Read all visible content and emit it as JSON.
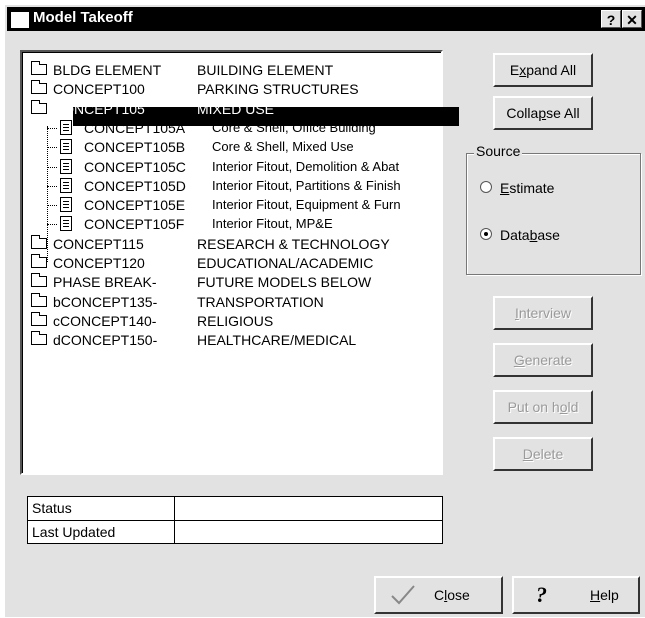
{
  "window": {
    "title": "Model Takeoff",
    "help_glyph": "?",
    "close_glyph": "✕"
  },
  "tree": {
    "nodes": [
      {
        "code": "BLDG ELEMENT",
        "desc": "BUILDING ELEMENT",
        "type": "folder"
      },
      {
        "code": "CONCEPT100",
        "desc": "PARKING STRUCTURES",
        "type": "folder"
      },
      {
        "code": "CONCEPT105",
        "desc": "MIXED USE",
        "type": "folder-open",
        "selected": true
      },
      {
        "code": "CONCEPT105A",
        "desc": "Core & Shell, Office Building",
        "type": "doc"
      },
      {
        "code": "CONCEPT105B",
        "desc": "Core & Shell, Mixed Use",
        "type": "doc"
      },
      {
        "code": "CONCEPT105C",
        "desc": "Interior Fitout, Demolition & Abat",
        "type": "doc"
      },
      {
        "code": "CONCEPT105D",
        "desc": "Interior Fitout, Partitions & Finish",
        "type": "doc"
      },
      {
        "code": "CONCEPT105E",
        "desc": "Interior Fitout, Equipment & Furn",
        "type": "doc"
      },
      {
        "code": "CONCEPT105F",
        "desc": "Interior Fitout, MP&E",
        "type": "doc"
      },
      {
        "code": "CONCEPT115",
        "desc": "RESEARCH & TECHNOLOGY",
        "type": "folder"
      },
      {
        "code": "CONCEPT120",
        "desc": "EDUCATIONAL/ACADEMIC",
        "type": "folder"
      },
      {
        "code": "PHASE BREAK-",
        "desc": "FUTURE MODELS BELOW",
        "type": "folder"
      },
      {
        "code": "bCONCEPT135-",
        "desc": "TRANSPORTATION",
        "type": "folder"
      },
      {
        "code": "cCONCEPT140-",
        "desc": "RELIGIOUS",
        "type": "folder"
      },
      {
        "code": "dCONCEPT150-",
        "desc": "HEALTHCARE/MEDICAL",
        "type": "folder"
      }
    ]
  },
  "buttons": {
    "expand_all": {
      "pre": "E",
      "key": "x",
      "post": "pand All"
    },
    "collapse_all": {
      "pre": "Colla",
      "key": "p",
      "post": "se All"
    },
    "interview": {
      "pre": "",
      "key": "I",
      "post": "nterview"
    },
    "generate": {
      "pre": "",
      "key": "G",
      "post": "enerate"
    },
    "put_on_hold": {
      "pre": "Put on h",
      "key": "o",
      "post": "ld"
    },
    "delete": {
      "pre": "",
      "key": "D",
      "post": "elete"
    },
    "close": {
      "pre": "C",
      "key": "l",
      "post": "ose"
    },
    "help": {
      "pre": "",
      "key": "H",
      "post": "elp"
    }
  },
  "source": {
    "legend": "Source",
    "options": [
      {
        "pre": "",
        "key": "E",
        "post": "stimate",
        "checked": false
      },
      {
        "pre": "Data",
        "key": "b",
        "post": "ase",
        "checked": true
      }
    ]
  },
  "status_table": {
    "rows": [
      {
        "label": "Status",
        "value": ""
      },
      {
        "label": "Last Updated",
        "value": ""
      }
    ]
  }
}
